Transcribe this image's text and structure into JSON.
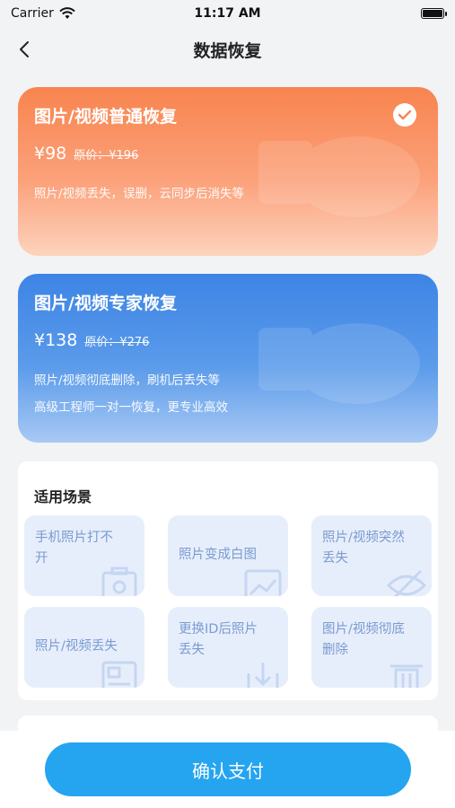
{
  "status_bar": {
    "carrier": "Carrier",
    "time": "11:17 AM"
  },
  "nav": {
    "title": "数据恢复"
  },
  "plans": [
    {
      "title": "图片/视频普通恢复",
      "price": "¥98",
      "original_price": "原价：¥196",
      "desc": [
        "照片/视频丢失，误删，云同步后消失等"
      ],
      "selected": true,
      "color": "#f8844f"
    },
    {
      "title": "图片/视频专家恢复",
      "price": "¥138",
      "original_price": "原价：¥276",
      "desc": [
        "照片/视频彻底删除，刷机后丢失等",
        "高级工程师一对一恢复，更专业高效"
      ],
      "selected": false,
      "color": "#3d84e5"
    }
  ],
  "scenarios": {
    "heading": "适用场景",
    "items": [
      {
        "label": "手机照片打不开",
        "icon": "camera-icon"
      },
      {
        "label": "照片变成白图",
        "icon": "image-icon"
      },
      {
        "label": "照片/视频突然丢失",
        "icon": "eye-off-icon"
      },
      {
        "label": "照片/视频丢失",
        "icon": "gallery-icon"
      },
      {
        "label": "更换ID后照片丢失",
        "icon": "download-icon"
      },
      {
        "label": "图片/视频彻底删除",
        "icon": "trash-icon"
      }
    ]
  },
  "footer": {
    "pay_label": "确认支付",
    "button_color": "#25a4f0"
  }
}
